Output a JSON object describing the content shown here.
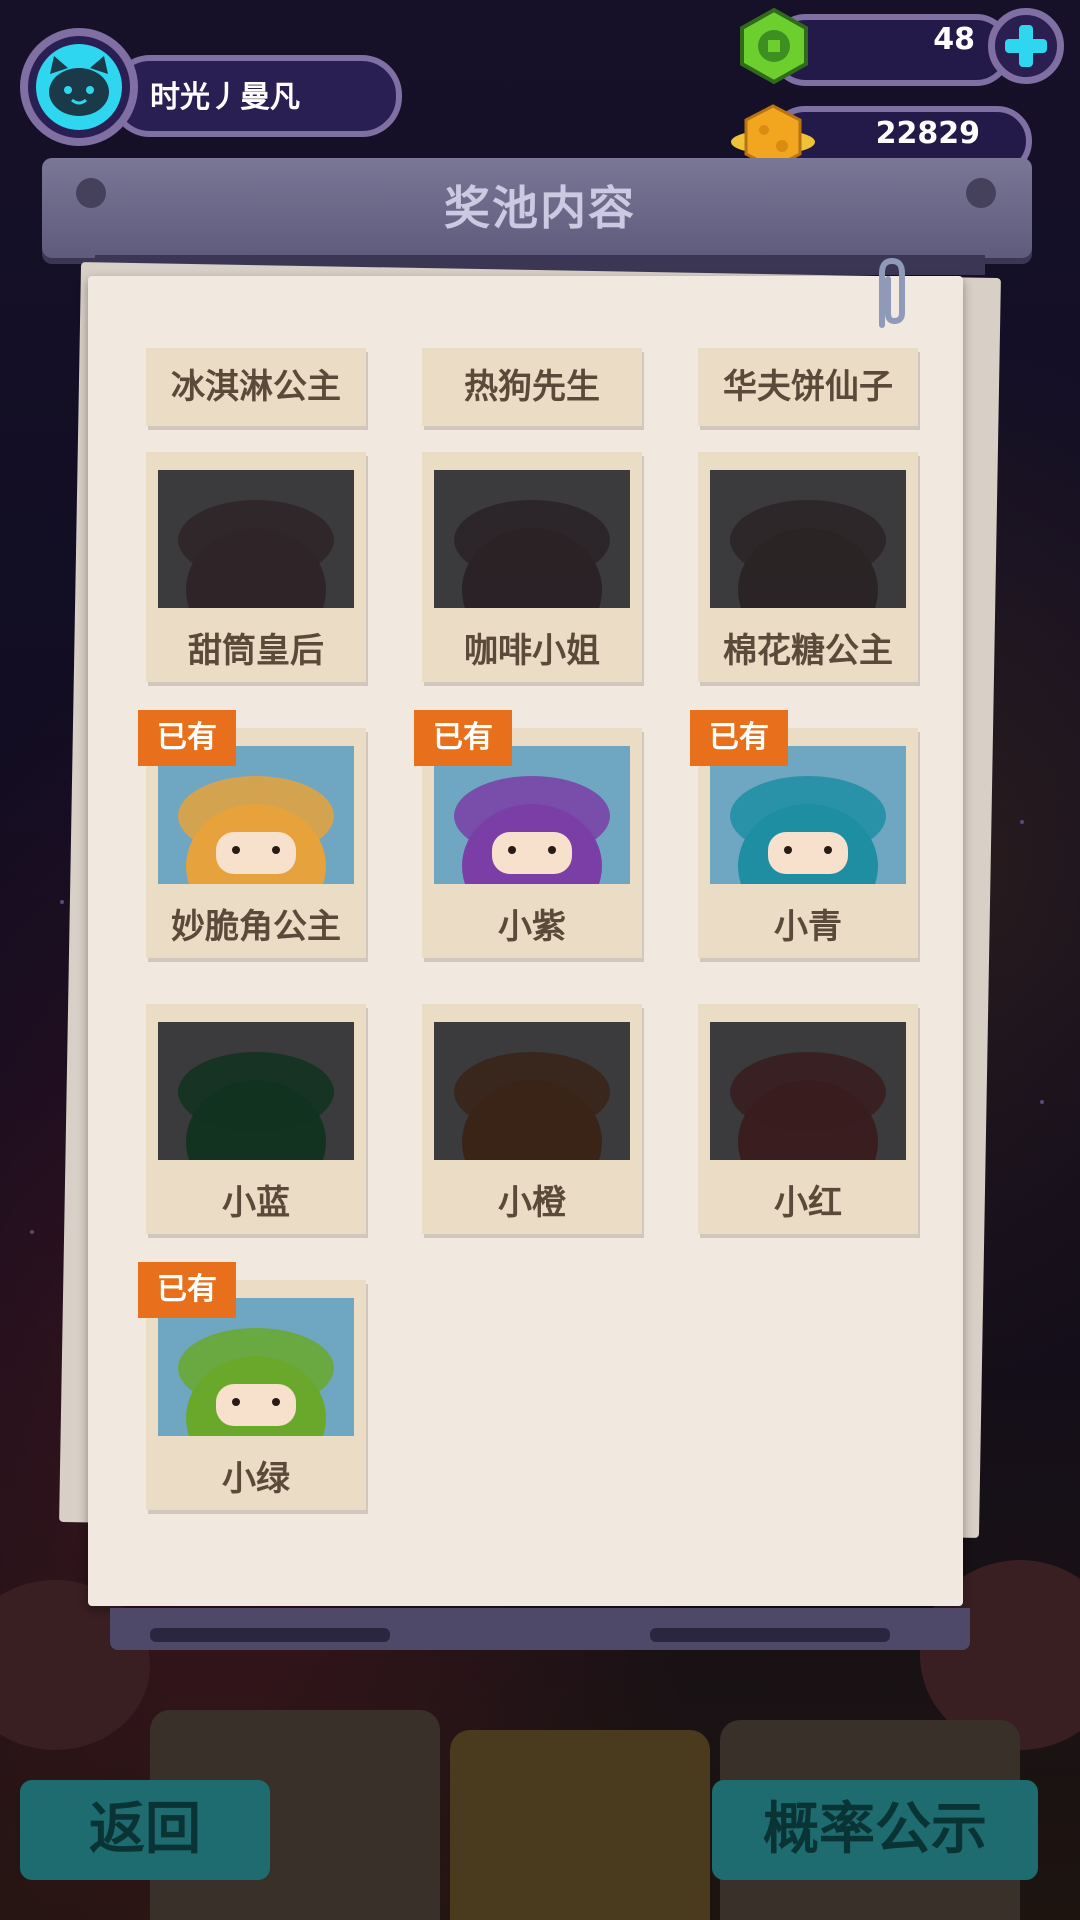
{
  "player": {
    "name": "时光丿曼凡",
    "avatar_icon": "cat-face-icon"
  },
  "currencies": [
    {
      "icon": "green-chip-coin-icon",
      "value": "48"
    },
    {
      "icon": "gold-planet-coin-icon",
      "value": "22829"
    }
  ],
  "add_button_icon": "plus-icon",
  "panel": {
    "title": "奖池内容"
  },
  "top_row": [
    "冰淇淋公主",
    "热狗先生",
    "华夫饼仙子"
  ],
  "cards": [
    {
      "name": "甜筒皇后",
      "owned": false,
      "color": "#2f2528"
    },
    {
      "name": "咖啡小姐",
      "owned": false,
      "color": "#2a2226"
    },
    {
      "name": "棉花糖公主",
      "owned": false,
      "color": "#2b2426"
    },
    {
      "name": "妙脆角公主",
      "owned": true,
      "color": "#e6a23c"
    },
    {
      "name": "小紫",
      "owned": true,
      "color": "#7b3ea6"
    },
    {
      "name": "小青",
      "owned": true,
      "color": "#1f8ea3"
    },
    {
      "name": "小蓝",
      "owned": false,
      "color": "#12331f"
    },
    {
      "name": "小橙",
      "owned": false,
      "color": "#3a2418"
    },
    {
      "name": "小红",
      "owned": false,
      "color": "#3a1d1f"
    },
    {
      "name": "小绿",
      "owned": true,
      "color": "#6aa82c"
    }
  ],
  "owned_badge": "已有",
  "buttons": {
    "back": "返回",
    "probability": "概率公示"
  }
}
